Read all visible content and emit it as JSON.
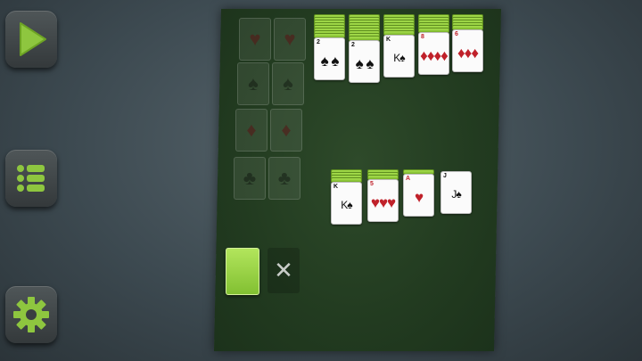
{
  "sidebar": {
    "buttons": [
      {
        "name": "play",
        "icon": "play-icon"
      },
      {
        "name": "menu",
        "icon": "menu-list-icon"
      },
      {
        "name": "settings",
        "icon": "gear-icon"
      }
    ],
    "accent": "#8ec63f"
  },
  "foundations": [
    {
      "suit": "♥",
      "color": "red"
    },
    {
      "suit": "♥",
      "color": "red"
    },
    {
      "suit": "♠",
      "color": "black"
    },
    {
      "suit": "♠",
      "color": "black"
    },
    {
      "suit": "♦",
      "color": "red"
    },
    {
      "suit": "♦",
      "color": "red"
    },
    {
      "suit": "♣",
      "color": "black"
    },
    {
      "suit": "♣",
      "color": "black"
    }
  ],
  "tableau_top": [
    {
      "rank": "2",
      "suit": "♠",
      "pips": "♠ ♠",
      "color": "black",
      "face_down": 8
    },
    {
      "rank": "2",
      "suit": "♠",
      "pips": "♠ ♠",
      "color": "black",
      "face_down": 9
    },
    {
      "rank": "K",
      "suit": "♠",
      "pips": "K♠",
      "color": "black",
      "face_down": 7
    },
    {
      "rank": "8",
      "suit": "♦",
      "pips": "♦♦♦♦",
      "color": "red",
      "face_down": 6
    },
    {
      "rank": "6",
      "suit": "♦",
      "pips": "♦♦♦",
      "color": "red",
      "face_down": 5
    }
  ],
  "tableau_bottom": [
    {
      "rank": "K",
      "suit": "♠",
      "pips": "K♠",
      "color": "black",
      "face_down": 4
    },
    {
      "rank": "5",
      "suit": "♥",
      "pips": "♥♥♥",
      "color": "red",
      "face_down": 3
    },
    {
      "rank": "A",
      "suit": "♥",
      "pips": "♥",
      "color": "red",
      "face_down": 1
    },
    {
      "rank": "J",
      "suit": "♠",
      "pips": "J♠",
      "color": "black",
      "face_down": 0
    }
  ],
  "stock": {
    "icon": "card-back"
  },
  "waste": {
    "icon": "close-x-icon",
    "glyph": "✕"
  }
}
